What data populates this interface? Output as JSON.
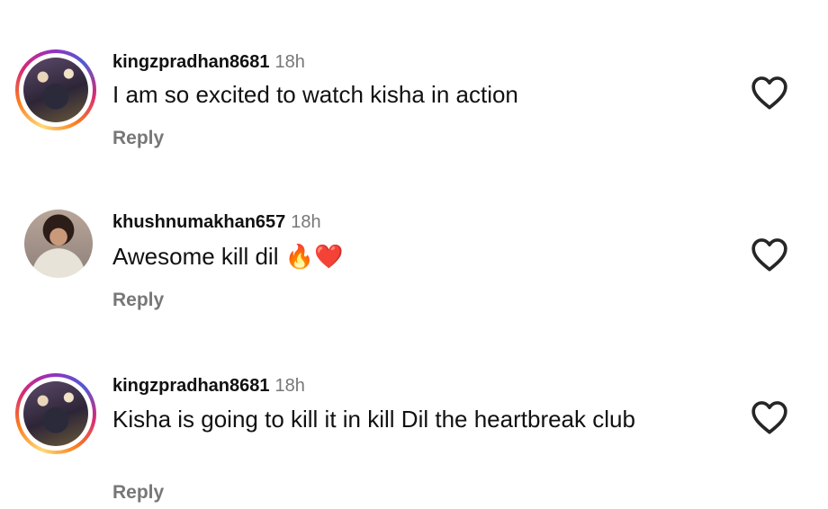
{
  "comments": [
    {
      "username": "kingzpradhan8681",
      "time": "18h",
      "text": "I am so excited to watch kisha in action",
      "emoji": "",
      "reply_label": "Reply",
      "has_story": true
    },
    {
      "username": "khushnumakhan657",
      "time": "18h",
      "text": "Awesome kill dil",
      "emoji": "🔥❤️",
      "reply_label": "Reply",
      "has_story": false
    },
    {
      "username": "kingzpradhan8681",
      "time": "18h",
      "text": "Kisha is going to kill it in kill Dil the heartbreak club",
      "emoji": "",
      "reply_label": "Reply",
      "has_story": true
    }
  ],
  "icons": {
    "like": "heart-outline-icon"
  },
  "colors": {
    "text": "#111111",
    "secondary": "#777777",
    "story_ring": [
      "#feda75",
      "#fa7e1e",
      "#d62976",
      "#962fbf"
    ]
  }
}
